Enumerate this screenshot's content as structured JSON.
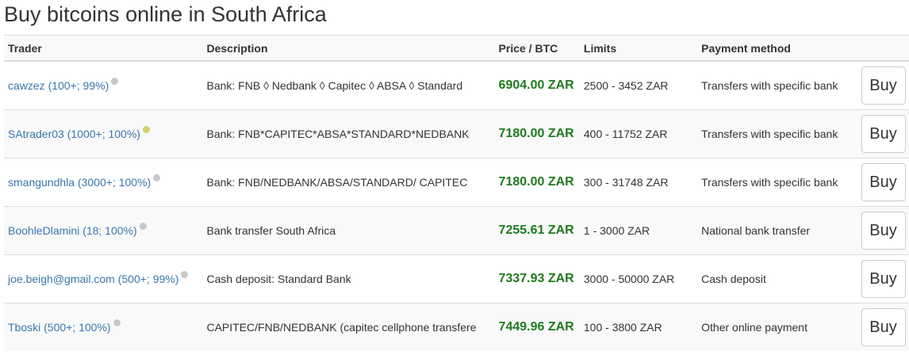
{
  "page": {
    "title": "Buy bitcoins online in South Africa"
  },
  "table": {
    "headers": {
      "trader": "Trader",
      "description": "Description",
      "price": "Price / BTC",
      "limits": "Limits",
      "payment": "Payment method"
    },
    "rows": [
      {
        "trader": "cawzez (100+; 99%)",
        "status_color": "#c8c8c8",
        "description": "Bank: FNB ◊ Nedbank ◊ Capitec ◊ ABSA ◊ Standard",
        "price": "6904.00 ZAR",
        "limits": "2500 - 3452 ZAR",
        "payment": "Transfers with specific bank",
        "button": "Buy"
      },
      {
        "trader": "SAtrader03 (1000+; 100%)",
        "status_color": "#d4d46a",
        "description": "Bank: FNB*CAPITEC*ABSA*STANDARD*NEDBANK",
        "price": "7180.00 ZAR",
        "limits": "400 - 11752 ZAR",
        "payment": "Transfers with specific bank",
        "button": "Buy"
      },
      {
        "trader": "smangundhla (3000+; 100%)",
        "status_color": "#c8c8c8",
        "description": "Bank: FNB/NEDBANK/ABSA/STANDARD/ CAPITEC",
        "price": "7180.00 ZAR",
        "limits": "300 - 31748 ZAR",
        "payment": "Transfers with specific bank",
        "button": "Buy"
      },
      {
        "trader": "BoohleDlamini (18; 100%)",
        "status_color": "#c8c8c8",
        "description": "Bank transfer South Africa",
        "price": "7255.61 ZAR",
        "limits": "1 - 3000 ZAR",
        "payment": "National bank transfer",
        "button": "Buy"
      },
      {
        "trader": "joe.beigh@gmail.com (500+; 99%)",
        "status_color": "#c8c8c8",
        "description": "Cash deposit: Standard Bank",
        "price": "7337.93 ZAR",
        "limits": "3000 - 50000 ZAR",
        "payment": "Cash deposit",
        "button": "Buy"
      },
      {
        "trader": "Tboski (500+; 100%)",
        "status_color": "#c8c8c8",
        "description": "CAPITEC/FNB/NEDBANK (capitec cellphone transfere",
        "price": "7449.96 ZAR",
        "limits": "100 - 3800 ZAR",
        "payment": "Other online payment",
        "button": "Buy"
      }
    ]
  },
  "colors": {
    "link": "#3a76b0",
    "price": "#1f7a1f",
    "stripe": "#f9f9f9",
    "border": "#dddddd"
  }
}
